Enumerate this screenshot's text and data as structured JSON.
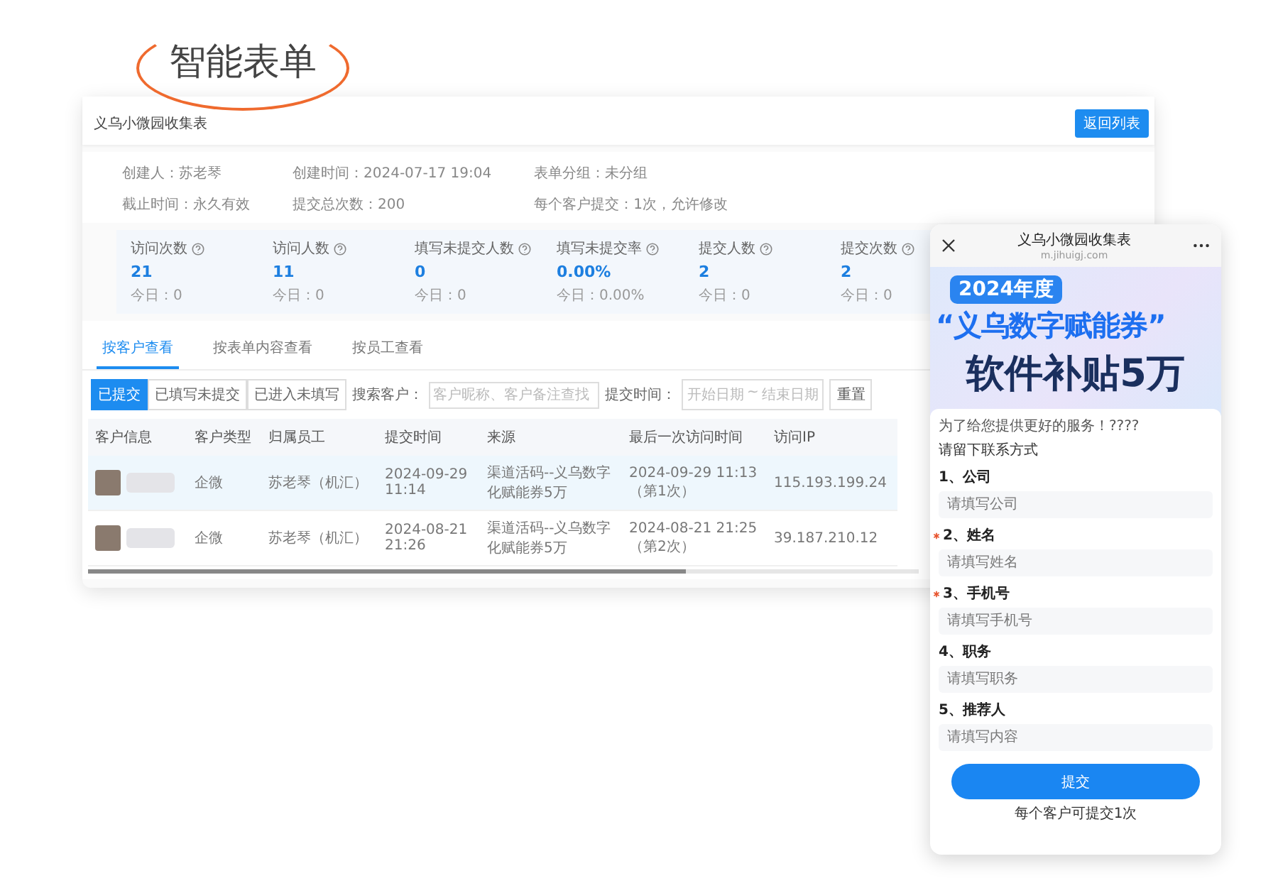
{
  "label": "智能表单",
  "form_window": {
    "title": "义乌小微园收集表",
    "back_button": "返回列表",
    "info": [
      "创建人：苏老琴",
      "创建时间：2024-07-17 19:04",
      "表单分组：未分组",
      "截止时间：永久有效",
      "提交总次数：200",
      "每个客户提交：1次，允许修改"
    ],
    "stats": [
      {
        "label": "访问次数",
        "value": "21",
        "today": "今日：0"
      },
      {
        "label": "访问人数",
        "value": "11",
        "today": "今日：0"
      },
      {
        "label": "填写未提交人数",
        "value": "0",
        "today": "今日：0"
      },
      {
        "label": "填写未提交率",
        "value": "0.00%",
        "today": "今日：0.00%"
      },
      {
        "label": "提交人数",
        "value": "2",
        "today": "今日：0"
      },
      {
        "label": "提交次数",
        "value": "2",
        "today": "今日：0"
      }
    ],
    "tabs": [
      {
        "label": "按客户查看",
        "selected": true
      },
      {
        "label": "按表单内容查看",
        "selected": false
      },
      {
        "label": "按员工查看",
        "selected": false
      }
    ],
    "filters": [
      {
        "label": "已提交",
        "selected": true
      },
      {
        "label": "已填写未提交",
        "selected": false
      },
      {
        "label": "已进入未填写",
        "selected": false
      }
    ],
    "search": {
      "label": "搜索客户：",
      "placeholder": "客户昵称、客户备注查找"
    },
    "date_filter": {
      "label": "提交时间：",
      "start_placeholder": "开始日期",
      "separator": "~",
      "end_placeholder": "结束日期"
    },
    "reset_button": "重置",
    "table": {
      "columns": [
        "客户信息",
        "客户类型",
        "归属员工",
        "提交时间",
        "来源",
        "最后一次访问时间",
        "访问IP"
      ],
      "rows": [
        {
          "selected": true,
          "customer_type": "企微",
          "owner": "苏老琴（机汇）",
          "submitted": "2024-09-29 11:14",
          "source": "渠道活码--义乌数字化赋能券5万",
          "last_visit": "2024-09-29 11:13（第1次）",
          "ip": "115.193.199.24"
        },
        {
          "selected": false,
          "customer_type": "企微",
          "owner": "苏老琴（机汇）",
          "submitted": "2024-08-21 21:26",
          "source": "渠道活码--义乌数字化赋能券5万",
          "last_visit": "2024-08-21 21:25（第2次）",
          "ip": "39.187.210.12"
        }
      ]
    }
  },
  "phone": {
    "title": "义乌小微园收集表",
    "url": "m.jihuigj.com",
    "banner": {
      "badge": "2024年度",
      "headline": "“义乌数字赋能券”",
      "subline": "软件补贴5万"
    },
    "intro": "为了给您提供更好的服务！????",
    "prompt": "请留下联系方式",
    "fields": [
      {
        "label": "1、公司",
        "placeholder": "请填写公司",
        "required": false
      },
      {
        "label": "2、姓名",
        "placeholder": "请填写姓名",
        "required": true
      },
      {
        "label": "3、手机号",
        "placeholder": "请填写手机号",
        "required": true
      },
      {
        "label": "4、职务",
        "placeholder": "请填写职务",
        "required": false
      },
      {
        "label": "5、推荐人",
        "placeholder": "请填写内容",
        "required": false
      }
    ],
    "submit": "提交",
    "note": "每个客户可提交1次"
  }
}
